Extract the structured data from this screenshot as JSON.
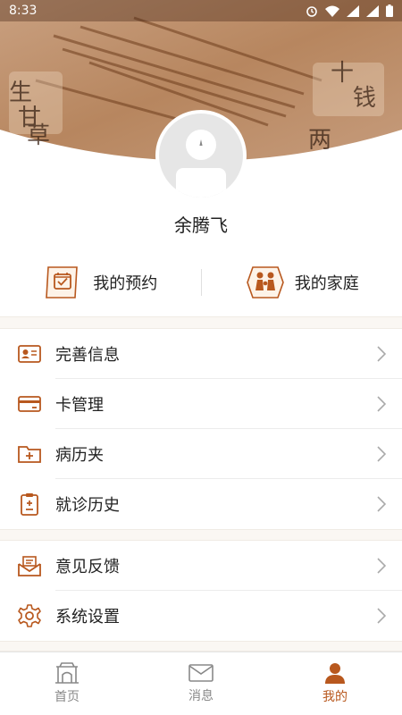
{
  "status_bar": {
    "time": "8:33"
  },
  "profile": {
    "name": "余腾飞"
  },
  "quick_actions": [
    {
      "label": "我的预约",
      "icon": "calendar-scroll-icon"
    },
    {
      "label": "我的家庭",
      "icon": "family-icon"
    }
  ],
  "menu_group_1": [
    {
      "label": "完善信息",
      "icon": "id-card-icon"
    },
    {
      "label": "卡管理",
      "icon": "card-icon"
    },
    {
      "label": "病历夹",
      "icon": "folder-plus-icon"
    },
    {
      "label": "就诊历史",
      "icon": "clipboard-icon"
    }
  ],
  "menu_group_2": [
    {
      "label": "意见反馈",
      "icon": "feedback-icon"
    },
    {
      "label": "系统设置",
      "icon": "gear-icon"
    }
  ],
  "tabs": [
    {
      "label": "首页",
      "icon": "home-gate-icon",
      "active": false
    },
    {
      "label": "消息",
      "icon": "envelope-icon",
      "active": false
    },
    {
      "label": "我的",
      "icon": "user-icon",
      "active": true
    }
  ],
  "colors": {
    "accent": "#b8581e",
    "icon": "#b8581e",
    "inactive": "#888888"
  }
}
